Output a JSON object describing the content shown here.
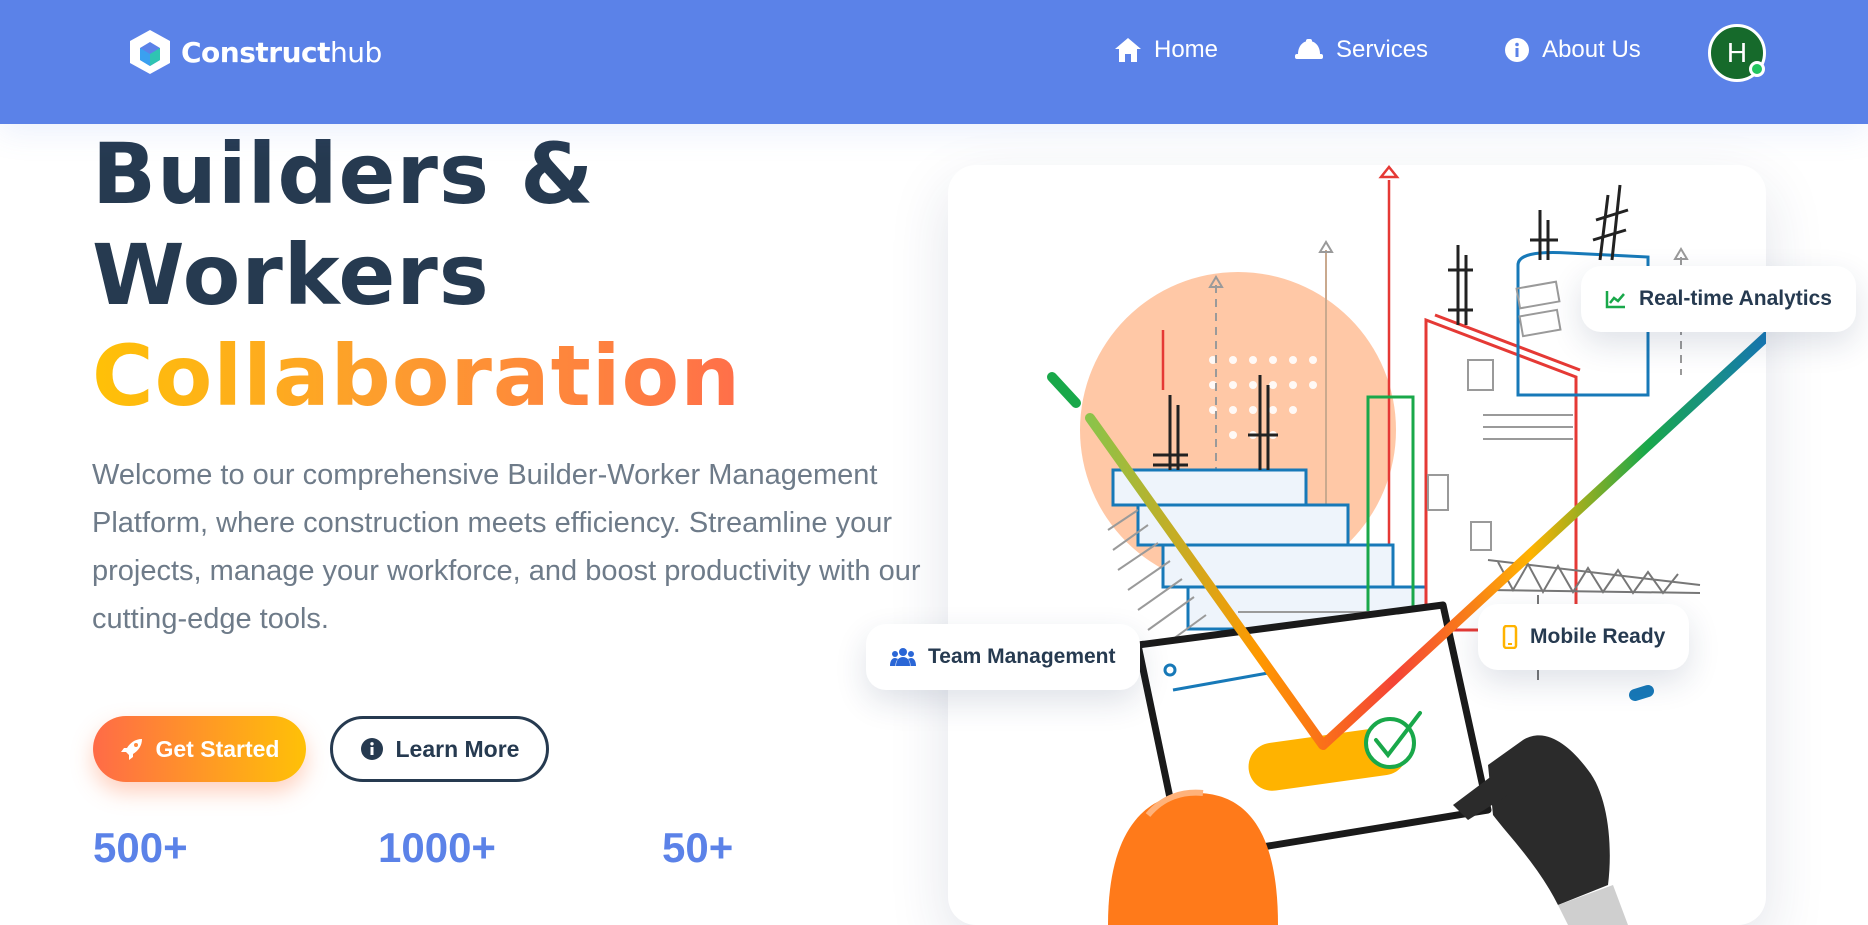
{
  "brand": {
    "name_bold": "Construct",
    "name_light": "hub"
  },
  "nav": {
    "items": [
      {
        "label": "Home",
        "icon": "home-icon"
      },
      {
        "label": "Services",
        "icon": "hardhat-icon"
      },
      {
        "label": "About Us",
        "icon": "info-icon"
      }
    ],
    "avatar_initial": "H"
  },
  "hero": {
    "title_line1": "Builders &",
    "title_line2": "Workers",
    "title_accent": "Collaboration",
    "description": "Welcome to our comprehensive Builder-Worker Management Platform, where construction meets efficiency. Streamline your projects, manage your workforce, and boost productivity with our cutting-edge tools.",
    "primary_button": "Get Started",
    "secondary_button": "Learn More"
  },
  "stats": [
    {
      "value": "500+"
    },
    {
      "value": "1000+"
    },
    {
      "value": "50+"
    }
  ],
  "badges": {
    "analytics": "Real-time Analytics",
    "team": "Team Management",
    "mobile": "Mobile Ready"
  },
  "colors": {
    "primary": "#5b82e8",
    "dark": "#263a50",
    "accent_start": "#ffc107",
    "accent_end": "#ff6f4a",
    "online": "#22c55e"
  }
}
